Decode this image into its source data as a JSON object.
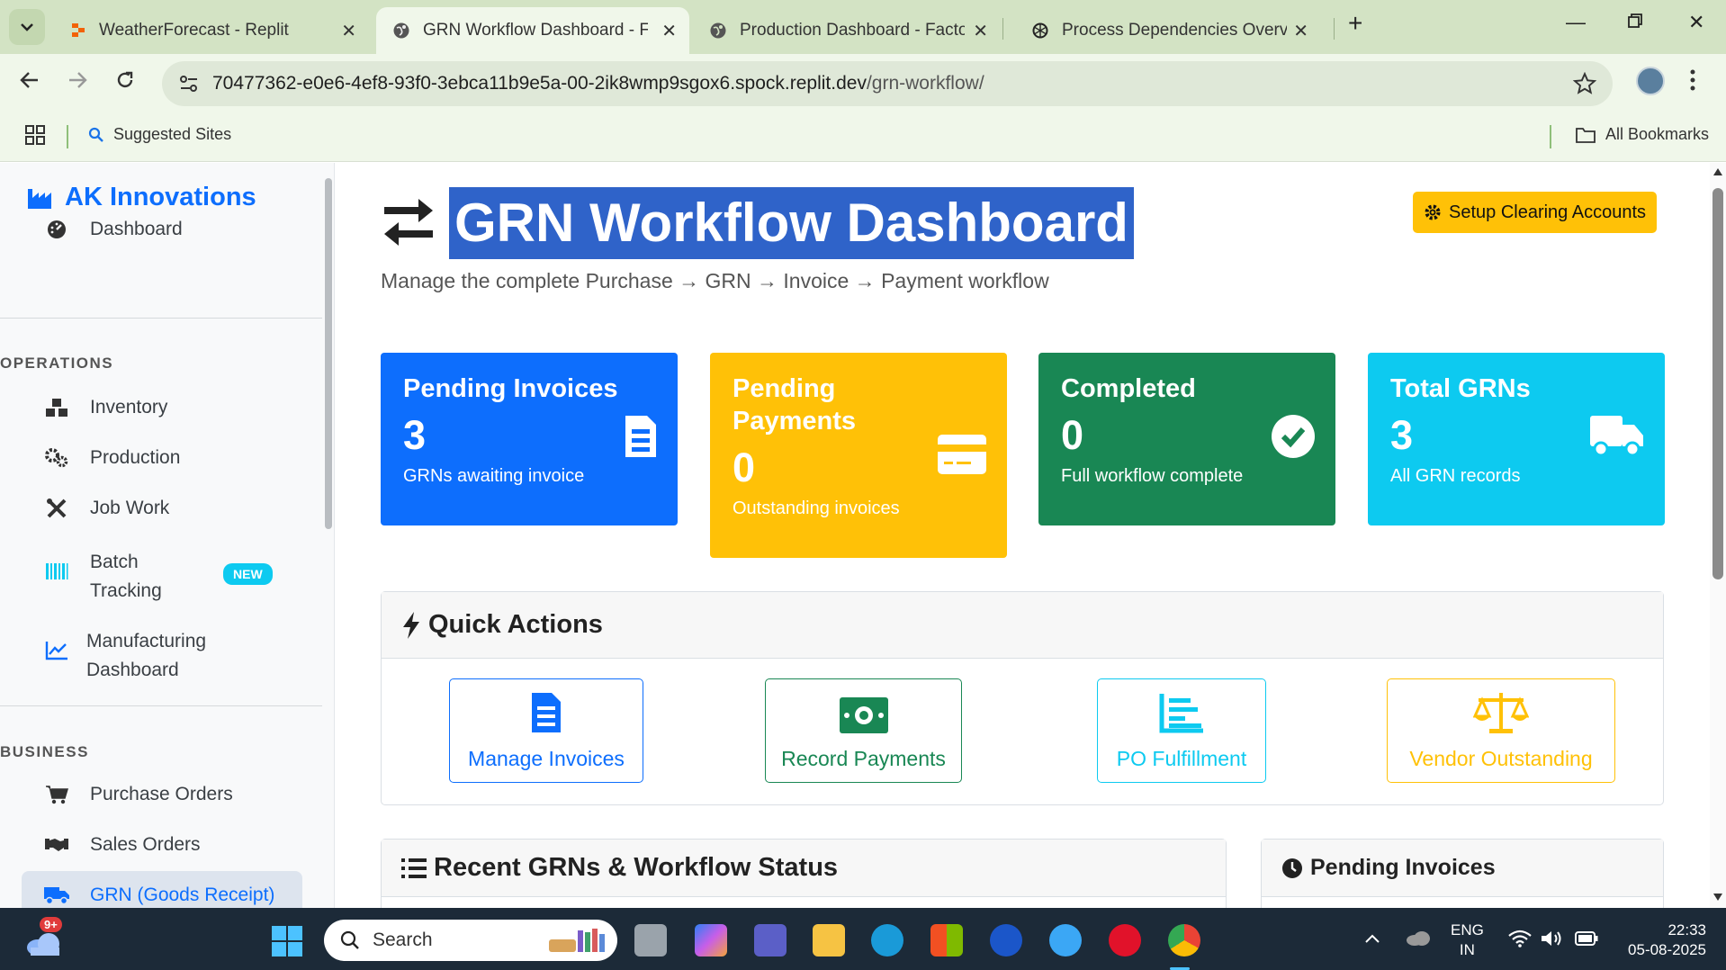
{
  "browser": {
    "tabs": [
      {
        "title": "WeatherForecast - Replit"
      },
      {
        "title": "GRN Workflow Dashboard - Fac"
      },
      {
        "title": "Production Dashboard - Factory"
      },
      {
        "title": "Process Dependencies Overview"
      }
    ],
    "url_host": "70477362-e0e6-4ef8-93f0-3ebca11b9e5a-00-2ik8wmp9sgox6.spock.replit.dev",
    "url_path": "/grn-workflow/",
    "bookmarks": {
      "suggested": "Suggested Sites",
      "all": "All Bookmarks"
    }
  },
  "sidebar": {
    "brand": "AK Innovations",
    "dashboard": "Dashboard",
    "operations_head": "OPERATIONS",
    "inventory": "Inventory",
    "production": "Production",
    "job_work": "Job Work",
    "batch_line1": "Batch",
    "batch_line2": "Tracking",
    "badge_new": "NEW",
    "mfg_line1": "Manufacturing",
    "mfg_line2": "Dashboard",
    "business_head": "BUSINESS",
    "purchase_orders": "Purchase Orders",
    "sales_orders": "Sales Orders",
    "grn": "GRN (Goods Receipt)"
  },
  "main": {
    "title": "GRN Workflow Dashboard",
    "subtitle": "Manage the complete Purchase → GRN → Invoice → Payment workflow",
    "setup_button": "Setup Clearing Accounts",
    "cards": [
      {
        "title": "Pending Invoices",
        "value": "3",
        "desc": "GRNs awaiting invoice",
        "color": "#0d6efd"
      },
      {
        "title": "Pending Payments",
        "value": "0",
        "desc": "Outstanding invoices",
        "color": "#ffc107"
      },
      {
        "title": "Completed",
        "value": "0",
        "desc": "Full workflow complete",
        "color": "#198754"
      },
      {
        "title": "Total GRNs",
        "value": "3",
        "desc": "All GRN records",
        "color": "#0dcaf0"
      }
    ],
    "quick_actions": {
      "title": "Quick Actions",
      "buttons": [
        {
          "label": "Manage Invoices",
          "color": "#0d6efd"
        },
        {
          "label": "Record Payments",
          "color": "#198754"
        },
        {
          "label": "PO Fulfillment",
          "color": "#0dcaf0"
        },
        {
          "label": "Vendor Outstanding",
          "color": "#ffc107"
        }
      ]
    },
    "recent_title": "Recent GRNs & Workflow Status",
    "pending_title": "Pending Invoices"
  },
  "taskbar": {
    "search": "Search",
    "notification_badge": "9+",
    "lang_line1": "ENG",
    "lang_line2": "IN",
    "time": "22:33",
    "date": "05-08-2025"
  }
}
